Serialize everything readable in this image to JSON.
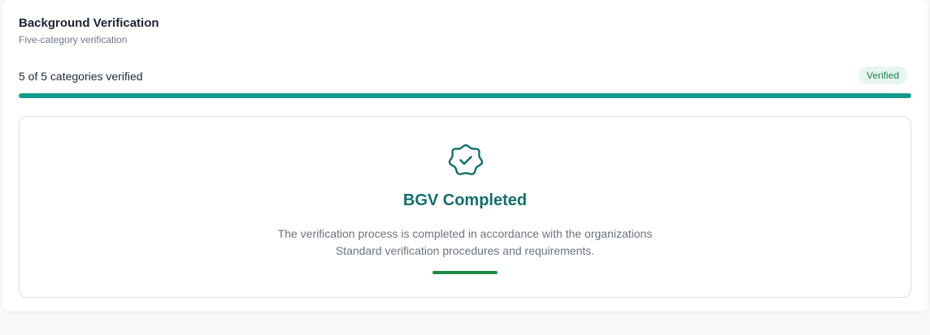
{
  "header": {
    "title": "Background Verification",
    "subtitle": "Five-category verification"
  },
  "progress": {
    "label": "5 of 5 categories verified",
    "verified": 5,
    "total": 5,
    "fraction": 1.0,
    "badge": "Verified"
  },
  "status": {
    "icon": "verified-seal-icon",
    "title": "BGV Completed",
    "description_line1": "The verification process is completed in accordance with the organizations",
    "description_line2": "Standard verification procedures and requirements."
  },
  "colors": {
    "accent": "#139a8a",
    "title_teal": "#136f6f",
    "success_green": "#1c8a46",
    "badge_bg": "#e7f6ef",
    "badge_text": "#1f7a55"
  }
}
